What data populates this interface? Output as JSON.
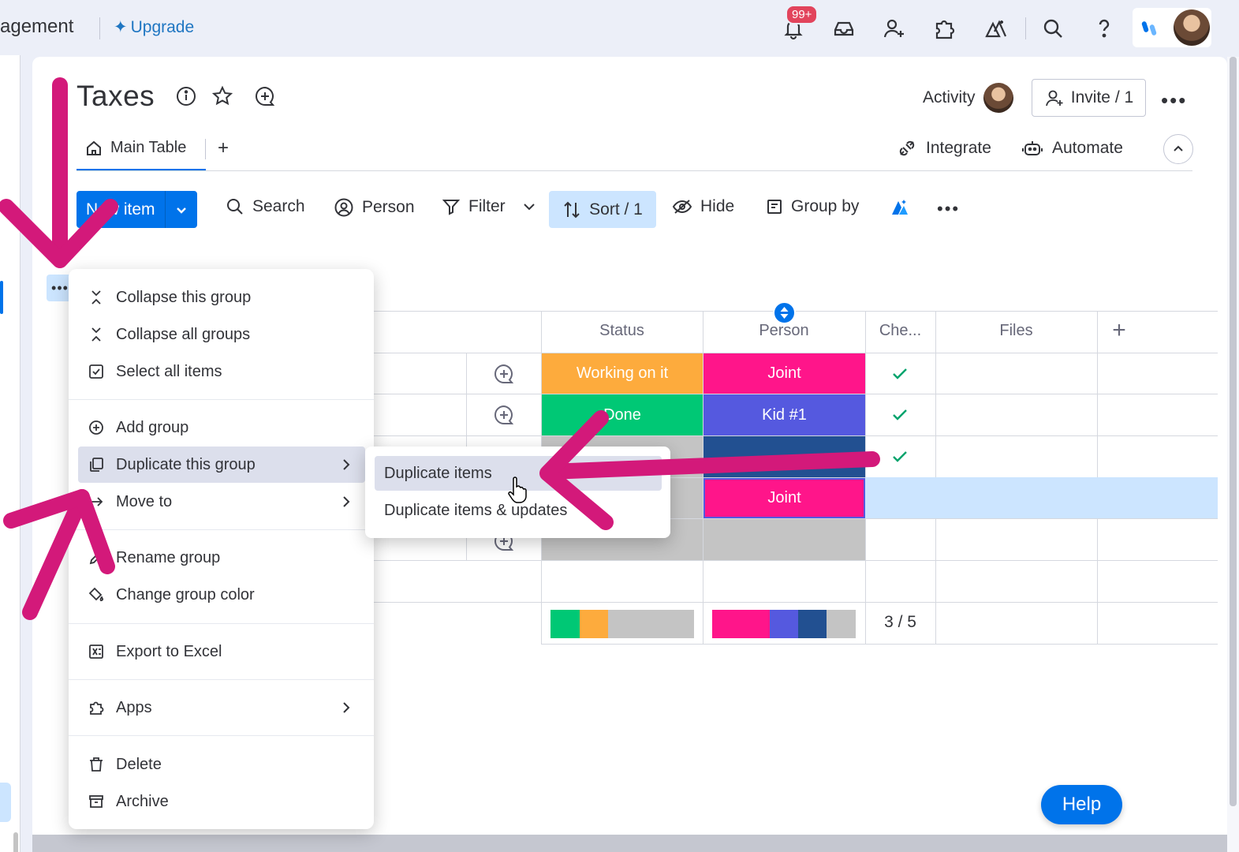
{
  "topbar": {
    "workspace": "agement",
    "upgrade": "Upgrade",
    "notification_count": "99+"
  },
  "board": {
    "title": "Taxes",
    "activity": "Activity",
    "invite": "Invite / 1"
  },
  "tabs": {
    "main": "Main Table",
    "add": "+",
    "integrate": "Integrate",
    "automate": "Automate"
  },
  "toolbar": {
    "new_item": "New item",
    "search": "Search",
    "person": "Person",
    "filter": "Filter",
    "sort": "Sort / 1",
    "hide": "Hide",
    "group_by": "Group by"
  },
  "table": {
    "columns": [
      "Status",
      "Person",
      "Che...",
      "Files",
      "+"
    ],
    "rows": [
      {
        "status": "Working on it",
        "person": "Joint",
        "checked": true
      },
      {
        "status": "Done",
        "person": "Kid #1",
        "checked": true
      },
      {
        "status": "",
        "person": "",
        "checked": true
      },
      {
        "status": "",
        "person": "Joint",
        "checked": false
      },
      {
        "status": "",
        "person": "",
        "checked": false
      }
    ],
    "summary_count": "3 / 5"
  },
  "menu": {
    "items": [
      {
        "label": "Collapse this group",
        "icon": "collapse-icon"
      },
      {
        "label": "Collapse all groups",
        "icon": "collapse-icon"
      },
      {
        "label": "Select all items",
        "icon": "checkbox-icon"
      },
      {
        "label": "Add group",
        "icon": "plus-circle-icon"
      },
      {
        "label": "Duplicate this group",
        "icon": "duplicate-icon"
      },
      {
        "label": "Move to",
        "icon": "arrow-right-icon"
      },
      {
        "label": "Rename group",
        "icon": "pencil-icon"
      },
      {
        "label": "Change group color",
        "icon": "paint-bucket-icon"
      },
      {
        "label": "Export to Excel",
        "icon": "excel-icon"
      },
      {
        "label": "Apps",
        "icon": "puzzle-icon"
      },
      {
        "label": "Delete",
        "icon": "trash-icon"
      },
      {
        "label": "Archive",
        "icon": "archive-icon"
      }
    ]
  },
  "submenu": {
    "items": [
      "Duplicate items",
      "Duplicate items & updates"
    ]
  },
  "help": "Help",
  "colors": {
    "primary": "#0073ea",
    "working_on_it": "#fdab3d",
    "done": "#00c875",
    "joint": "#ff158a",
    "kid1": "#5559df",
    "dark_blue": "#225091",
    "empty": "#c4c4c4",
    "annotation_arrow": "#d3197a"
  }
}
